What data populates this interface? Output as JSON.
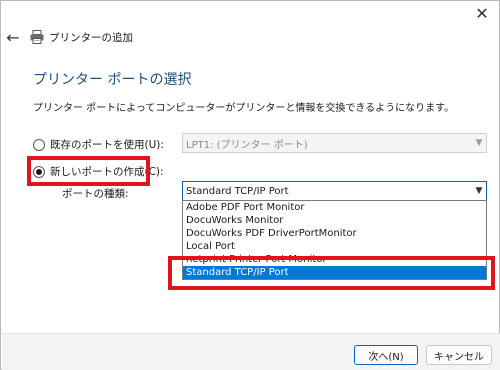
{
  "window": {
    "close_glyph": "✕",
    "back_glyph": "←",
    "title": "プリンターの追加",
    "title_icon": "printer-icon"
  },
  "page": {
    "heading": "プリンター ポートの選択",
    "description": "プリンター ポートによってコンピューターがプリンターと情報を交換できるようになります。"
  },
  "options": {
    "existing_port_label": "既存のポートを使用(U):",
    "existing_port_value": "LPT1: (プリンター ポート)",
    "new_port_label": "新しいポートの作成(C):",
    "port_type_label": "ポートの種類:",
    "port_type_value": "Standard TCP/IP Port",
    "selected": "new"
  },
  "dropdown": {
    "items": [
      "Adobe PDF Port Monitor",
      "DocuWorks Monitor",
      "DocuWorks PDF DriverPortMonitor",
      "Local Port",
      "netprint Printer Port Monitor",
      "Standard TCP/IP Port"
    ],
    "selected_index": 5
  },
  "buttons": {
    "next_label": "次へ(N)",
    "cancel_label": "キャンセル"
  },
  "colors": {
    "heading": "#1f4e79",
    "selection": "#0078d7",
    "highlight_box": "#e0141e"
  }
}
